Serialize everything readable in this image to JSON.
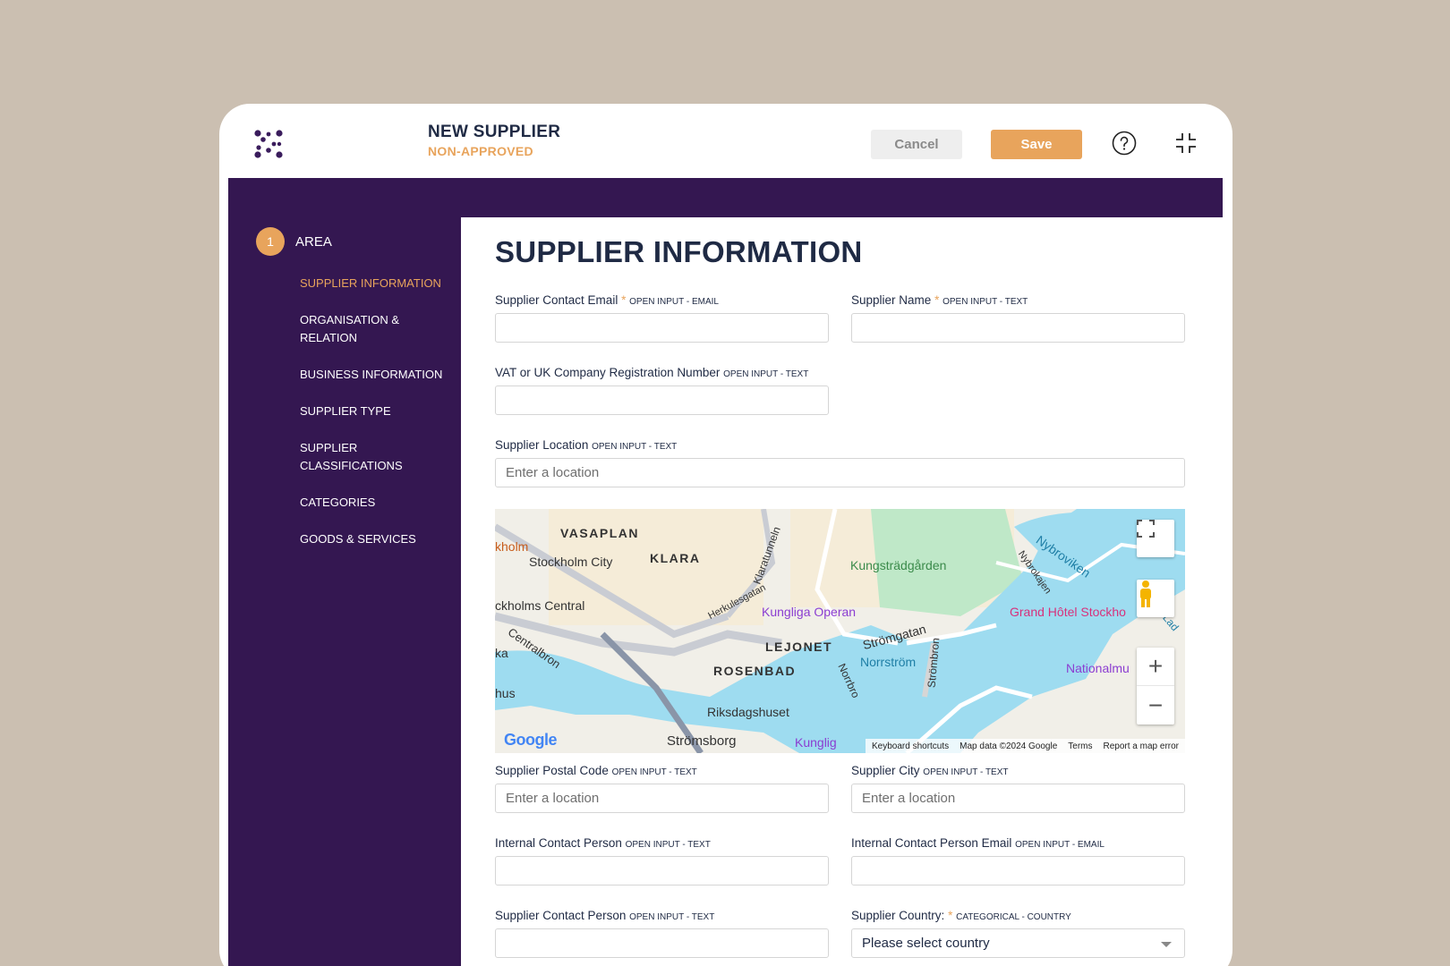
{
  "header": {
    "title": "NEW SUPPLIER",
    "status": "NON-APPROVED",
    "cancel_label": "Cancel",
    "save_label": "Save",
    "help_icon": "question-circle-icon",
    "collapse_icon": "collapse-icon"
  },
  "colors": {
    "accent": "#e8a45c",
    "sidebar": "#341751",
    "text": "#1f2a44",
    "background": "#cbbfb1"
  },
  "sidebar": {
    "step_number": "1",
    "step_label": "AREA",
    "items": [
      {
        "label": "SUPPLIER INFORMATION",
        "active": true
      },
      {
        "label": "ORGANISATION & RELATION",
        "active": false
      },
      {
        "label": "BUSINESS INFORMATION",
        "active": false
      },
      {
        "label": "SUPPLIER TYPE",
        "active": false
      },
      {
        "label": "SUPPLIER CLASSIFICATIONS",
        "active": false
      },
      {
        "label": "CATEGORIES",
        "active": false
      },
      {
        "label": "GOODS & SERVICES",
        "active": false
      }
    ]
  },
  "main": {
    "title": "SUPPLIER INFORMATION",
    "fields": {
      "contact_email": {
        "label": "Supplier Contact Email",
        "required": "*",
        "meta": "OPEN INPUT - EMAIL",
        "value": "",
        "placeholder": ""
      },
      "name": {
        "label": "Supplier Name",
        "required": "*",
        "meta": "OPEN INPUT - TEXT",
        "value": "",
        "placeholder": ""
      },
      "vat": {
        "label": "VAT or UK Company Registration Number",
        "meta": "OPEN INPUT - TEXT",
        "value": "",
        "placeholder": ""
      },
      "location": {
        "label": "Supplier Location",
        "meta": "OPEN INPUT - TEXT",
        "value": "",
        "placeholder": "Enter a location"
      },
      "postal_code": {
        "label": "Supplier Postal Code",
        "meta": "OPEN INPUT - TEXT",
        "value": "",
        "placeholder": "Enter a location"
      },
      "city": {
        "label": "Supplier City",
        "meta": "OPEN INPUT - TEXT",
        "value": "",
        "placeholder": "Enter a location"
      },
      "internal_contact": {
        "label": "Internal Contact Person",
        "meta": "OPEN INPUT - TEXT",
        "value": "",
        "placeholder": ""
      },
      "internal_email": {
        "label": "Internal Contact Person Email",
        "meta": "OPEN INPUT - EMAIL",
        "value": "",
        "placeholder": ""
      },
      "supplier_contact": {
        "label": "Supplier Contact Person",
        "meta": "OPEN INPUT - TEXT",
        "value": "",
        "placeholder": ""
      },
      "country": {
        "label": "Supplier Country:",
        "required": "*",
        "meta": "CATEGORICAL - COUNTRY",
        "selected": "Please select country"
      }
    }
  },
  "map": {
    "labels": {
      "vasaplan": "VASAPLAN",
      "klara": "KLARA",
      "holm": "kholm",
      "stockholm_city": "Stockholm City",
      "stockholms_central": "ckholms Central",
      "klaratunneln": "Klaratunneln",
      "herkulesgatan": "Herkulesgatan",
      "kungstradgarden": "Kungsträdgården",
      "kungliga_operan": "Kungliga Operan",
      "grand_hotel": "Grand Hôtel Stockho",
      "nybroviken": "Nybroviken",
      "nybrokajen": "Nybrokajen",
      "lejonet": "LEJONET",
      "stromgatan": "Strömgatan",
      "norrstrom": "Norrström",
      "strombron": "Strömbron",
      "nationalmu": "Nationalmu",
      "centralbron": "Centralbron",
      "rosenbad": "ROSENBAD",
      "norrbro": "Norrbro",
      "riksdagshuset": "Riksdagshuset",
      "stromsborg": "Strömsborg",
      "kunglig": "Kunglig",
      "ka": "ka",
      "hus": "hus",
      "lad": "Lad"
    },
    "logo": "Google",
    "footer": {
      "shortcuts": "Keyboard shortcuts",
      "data": "Map data ©2024 Google",
      "terms": "Terms",
      "report": "Report a map error"
    },
    "controls": {
      "fullscreen_icon": "fullscreen-icon",
      "pegman_icon": "pegman-icon",
      "zoom_in": "+",
      "zoom_out": "−"
    }
  }
}
